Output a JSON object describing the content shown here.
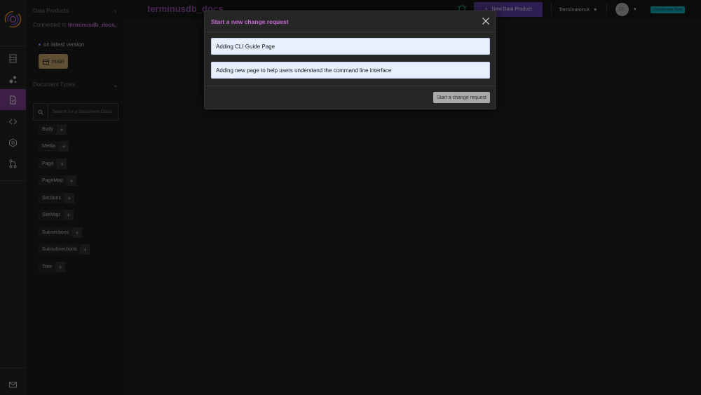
{
  "header": {
    "data_product_title": "terminusdb_docs",
    "new_data_product_label": "New Data Product",
    "team_name": "TerminatorsX",
    "avatar_initials": "OL",
    "role_badge": "Collaborator Role"
  },
  "sidebar": {
    "data_products_label": "Data Products",
    "connected_prefix": "Connected to",
    "connected_db": "terminusdb_docs",
    "version_status": "on latest version",
    "branch_name": "main",
    "document_types_label": "Document Types",
    "search_placeholder": "Search for a Document Class",
    "document_types": [
      "Body",
      "Media",
      "Page",
      "PageMap",
      "Sections",
      "SiteMap",
      "Subsections",
      "Subsubsections",
      "Tree"
    ]
  },
  "rail": {
    "icons": [
      "logo-icon",
      "database-icon",
      "graph-icon",
      "document-icon",
      "code-icon",
      "schema-icon",
      "branch-icon",
      "mail-icon"
    ]
  },
  "modal": {
    "title": "Start a new change request",
    "name_value": "Adding CLI Guide Page",
    "description_value": "Adding new page to help users understand the command line interface",
    "submit_label": "Start a change request"
  },
  "colors": {
    "accent_purple": "#8e4aa3",
    "active_rail": "#7b3f8a",
    "branch_gold": "#bfa06a",
    "role_teal": "#12a6b4"
  }
}
